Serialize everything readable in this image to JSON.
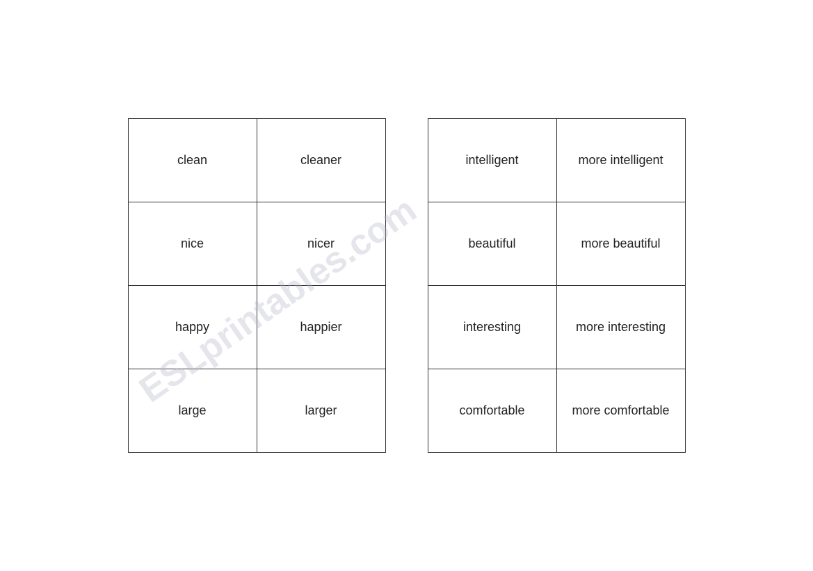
{
  "left_table": {
    "rows": [
      [
        "clean",
        "cleaner"
      ],
      [
        "nice",
        "nicer"
      ],
      [
        "happy",
        "happier"
      ],
      [
        "large",
        "larger"
      ]
    ]
  },
  "right_table": {
    "rows": [
      [
        "intelligent",
        "more intelligent"
      ],
      [
        "beautiful",
        "more beautiful"
      ],
      [
        "interesting",
        "more interesting"
      ],
      [
        "comfortable",
        "more comfortable"
      ]
    ]
  },
  "watermark": "ESLprintables.com"
}
